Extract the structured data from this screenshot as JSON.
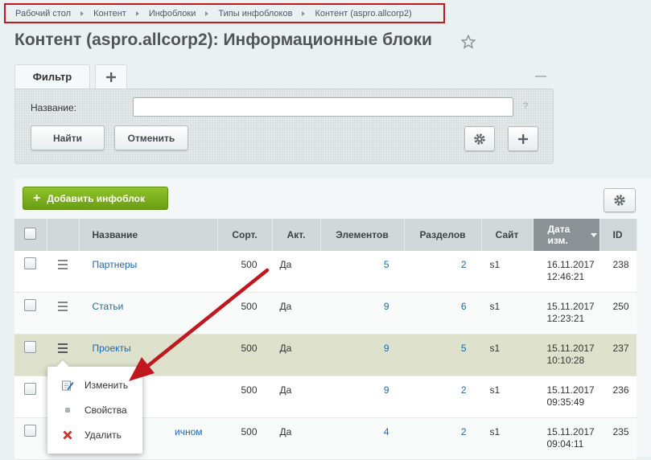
{
  "breadcrumb": [
    "Рабочий стол",
    "Контент",
    "Инфоблоки",
    "Типы инфоблоков",
    "Контент (aspro.allcorp2)"
  ],
  "page": {
    "title": "Контент (aspro.allcorp2): Информационные блоки"
  },
  "filter": {
    "tab_label": "Фильтр",
    "name_label": "Название:",
    "name_value": "",
    "help": "?",
    "find_label": "Найти",
    "cancel_label": "Отменить"
  },
  "list": {
    "add_label": "Добавить инфоблок",
    "columns": {
      "name": "Название",
      "sort": "Сорт.",
      "active": "Акт.",
      "elements": "Элементов",
      "sections": "Разделов",
      "site": "Сайт",
      "date": "Дата изм.",
      "id": "ID"
    },
    "rows": [
      {
        "name": "Партнеры",
        "sort": "500",
        "active": "Да",
        "elements": "5",
        "sections": "2",
        "site": "s1",
        "date": "16.11.2017",
        "time": "12:46:21",
        "id": "238"
      },
      {
        "name": "Статьи",
        "sort": "500",
        "active": "Да",
        "elements": "9",
        "sections": "6",
        "site": "s1",
        "date": "15.11.2017",
        "time": "12:23:21",
        "id": "250"
      },
      {
        "name": "Проекты",
        "sort": "500",
        "active": "Да",
        "elements": "9",
        "sections": "5",
        "site": "s1",
        "date": "15.11.2017",
        "time": "10:10:28",
        "id": "237"
      },
      {
        "name": "",
        "sort": "500",
        "active": "Да",
        "elements": "9",
        "sections": "2",
        "site": "s1",
        "date": "15.11.2017",
        "time": "09:35:49",
        "id": "236"
      },
      {
        "name": "ичном",
        "sort": "500",
        "active": "Да",
        "elements": "4",
        "sections": "2",
        "site": "s1",
        "date": "15.11.2017",
        "time": "09:04:11",
        "id": "235"
      }
    ]
  },
  "context_menu": {
    "edit": "Изменить",
    "props": "Свойства",
    "delete": "Удалить"
  },
  "colors": {
    "accent_green": "#7cb518",
    "breadcrumb_border": "#c0181e",
    "link": "#2067b0",
    "arrow": "#c0181e"
  }
}
